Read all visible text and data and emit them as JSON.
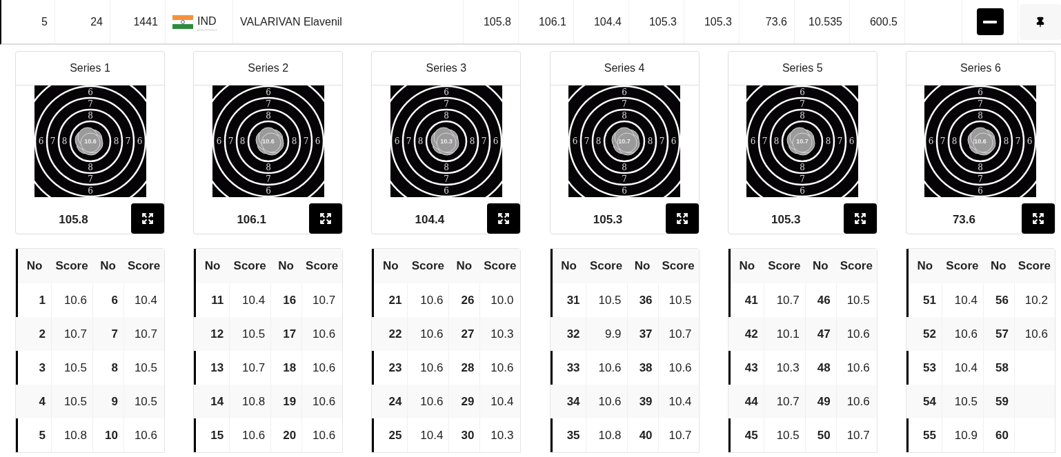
{
  "row": {
    "column_1": "5",
    "column_2": "24",
    "column_3": "1441",
    "country": "IND",
    "name": "VALARIVAN Elavenil",
    "series_scores": [
      "105.8",
      "106.1",
      "104.4",
      "105.3",
      "105.3",
      "73.6"
    ],
    "column_10": "10.535",
    "column_11": "600.5",
    "expanded": true
  },
  "series": [
    {
      "title": "Series 1",
      "ring_labels": [
        "6",
        "7",
        "8",
        "6",
        "7",
        "8",
        "8",
        "7",
        "6",
        "8",
        "7",
        "6"
      ],
      "shot_label": "10.6",
      "score": "105.8",
      "headers": [
        "No",
        "Score",
        "No",
        "Score"
      ],
      "shots": [
        {
          "no": "1",
          "score": "10.6"
        },
        {
          "no": "2",
          "score": "10.7"
        },
        {
          "no": "3",
          "score": "10.5"
        },
        {
          "no": "4",
          "score": "10.5"
        },
        {
          "no": "5",
          "score": "10.8"
        },
        {
          "no": "6",
          "score": "10.4"
        },
        {
          "no": "7",
          "score": "10.7"
        },
        {
          "no": "8",
          "score": "10.5"
        },
        {
          "no": "9",
          "score": "10.5"
        },
        {
          "no": "10",
          "score": "10.6"
        }
      ]
    },
    {
      "title": "Series 2",
      "ring_labels": [
        "6",
        "7",
        "8",
        "6",
        "7",
        "8",
        "8",
        "7",
        "6",
        "8",
        "7",
        "6"
      ],
      "shot_label": "10.6",
      "score": "106.1",
      "headers": [
        "No",
        "Score",
        "No",
        "Score"
      ],
      "shots": [
        {
          "no": "11",
          "score": "10.4"
        },
        {
          "no": "12",
          "score": "10.5"
        },
        {
          "no": "13",
          "score": "10.7"
        },
        {
          "no": "14",
          "score": "10.8"
        },
        {
          "no": "15",
          "score": "10.6"
        },
        {
          "no": "16",
          "score": "10.7"
        },
        {
          "no": "17",
          "score": "10.6"
        },
        {
          "no": "18",
          "score": "10.6"
        },
        {
          "no": "19",
          "score": "10.6"
        },
        {
          "no": "20",
          "score": "10.6"
        }
      ]
    },
    {
      "title": "Series 3",
      "ring_labels": [
        "6",
        "7",
        "8",
        "6",
        "7",
        "8",
        "8",
        "7",
        "6",
        "8",
        "7",
        "6"
      ],
      "shot_label": "10.3",
      "score": "104.4",
      "headers": [
        "No",
        "Score",
        "No",
        "Score"
      ],
      "shots": [
        {
          "no": "21",
          "score": "10.6"
        },
        {
          "no": "22",
          "score": "10.6"
        },
        {
          "no": "23",
          "score": "10.6"
        },
        {
          "no": "24",
          "score": "10.6"
        },
        {
          "no": "25",
          "score": "10.4"
        },
        {
          "no": "26",
          "score": "10.0"
        },
        {
          "no": "27",
          "score": "10.3"
        },
        {
          "no": "28",
          "score": "10.6"
        },
        {
          "no": "29",
          "score": "10.4"
        },
        {
          "no": "30",
          "score": "10.3"
        }
      ]
    },
    {
      "title": "Series 4",
      "ring_labels": [
        "6",
        "7",
        "8",
        "6",
        "7",
        "8",
        "8",
        "7",
        "6",
        "8",
        "7",
        "6"
      ],
      "shot_label": "10.7",
      "score": "105.3",
      "headers": [
        "No",
        "Score",
        "No",
        "Score"
      ],
      "shots": [
        {
          "no": "31",
          "score": "10.5"
        },
        {
          "no": "32",
          "score": "9.9"
        },
        {
          "no": "33",
          "score": "10.6"
        },
        {
          "no": "34",
          "score": "10.6"
        },
        {
          "no": "35",
          "score": "10.8"
        },
        {
          "no": "36",
          "score": "10.5"
        },
        {
          "no": "37",
          "score": "10.7"
        },
        {
          "no": "38",
          "score": "10.6"
        },
        {
          "no": "39",
          "score": "10.4"
        },
        {
          "no": "40",
          "score": "10.7"
        }
      ]
    },
    {
      "title": "Series 5",
      "ring_labels": [
        "6",
        "7",
        "8",
        "6",
        "7",
        "8",
        "8",
        "7",
        "6",
        "8",
        "7",
        "6"
      ],
      "shot_label": "10.7",
      "score": "105.3",
      "headers": [
        "No",
        "Score",
        "No",
        "Score"
      ],
      "shots": [
        {
          "no": "41",
          "score": "10.7"
        },
        {
          "no": "42",
          "score": "10.1"
        },
        {
          "no": "43",
          "score": "10.3"
        },
        {
          "no": "44",
          "score": "10.7"
        },
        {
          "no": "45",
          "score": "10.5"
        },
        {
          "no": "46",
          "score": "10.5"
        },
        {
          "no": "47",
          "score": "10.6"
        },
        {
          "no": "48",
          "score": "10.6"
        },
        {
          "no": "49",
          "score": "10.6"
        },
        {
          "no": "50",
          "score": "10.7"
        }
      ]
    },
    {
      "title": "Series 6",
      "ring_labels": [
        "6",
        "7",
        "8",
        "6",
        "7",
        "8",
        "8",
        "7",
        "6",
        "8",
        "7",
        "6"
      ],
      "shot_label": "10.6",
      "score": "73.6",
      "headers": [
        "No",
        "Score",
        "No",
        "Score"
      ],
      "shots": [
        {
          "no": "51",
          "score": "10.4"
        },
        {
          "no": "52",
          "score": "10.6"
        },
        {
          "no": "53",
          "score": "10.4"
        },
        {
          "no": "54",
          "score": "10.5"
        },
        {
          "no": "55",
          "score": "10.9"
        },
        {
          "no": "56",
          "score": "10.2"
        },
        {
          "no": "57",
          "score": "10.6"
        },
        {
          "no": "58"
        },
        {
          "no": "59"
        },
        {
          "no": "60"
        }
      ]
    }
  ]
}
